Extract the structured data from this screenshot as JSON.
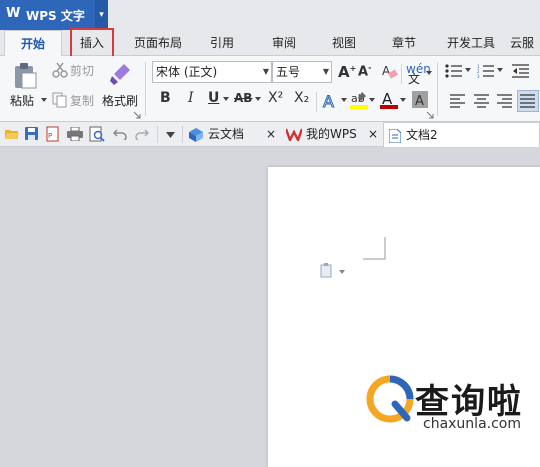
{
  "app": {
    "logo": "W",
    "name": "WPS 文字",
    "menu_arrow": "▾"
  },
  "tabs": [
    {
      "label": "开始"
    },
    {
      "label": "插入"
    },
    {
      "label": "页面布局"
    },
    {
      "label": "引用"
    },
    {
      "label": "审阅"
    },
    {
      "label": "视图"
    },
    {
      "label": "章节"
    },
    {
      "label": "开发工具"
    },
    {
      "label": "云服"
    }
  ],
  "ribbon": {
    "paste": "粘贴",
    "cut": "剪切",
    "copy": "复制",
    "format_painter": "格式刷",
    "font": "宋体 (正文)",
    "size": "五号",
    "bold": "B",
    "italic": "I",
    "underline": "U",
    "strike": "AB",
    "superscript": "X²",
    "subscript": "X₂"
  },
  "doc_tabs": [
    {
      "label": "云文档"
    },
    {
      "label": "我的WPS"
    },
    {
      "label": "文档2"
    }
  ],
  "watermark": {
    "text": "查询啦",
    "url": "chaxunla.com"
  },
  "colors": {
    "accent": "#2e67b9",
    "highlight_box": "#d93b3b",
    "font_color_bar": "#c00000",
    "highlight_bar": "#ffff00"
  }
}
